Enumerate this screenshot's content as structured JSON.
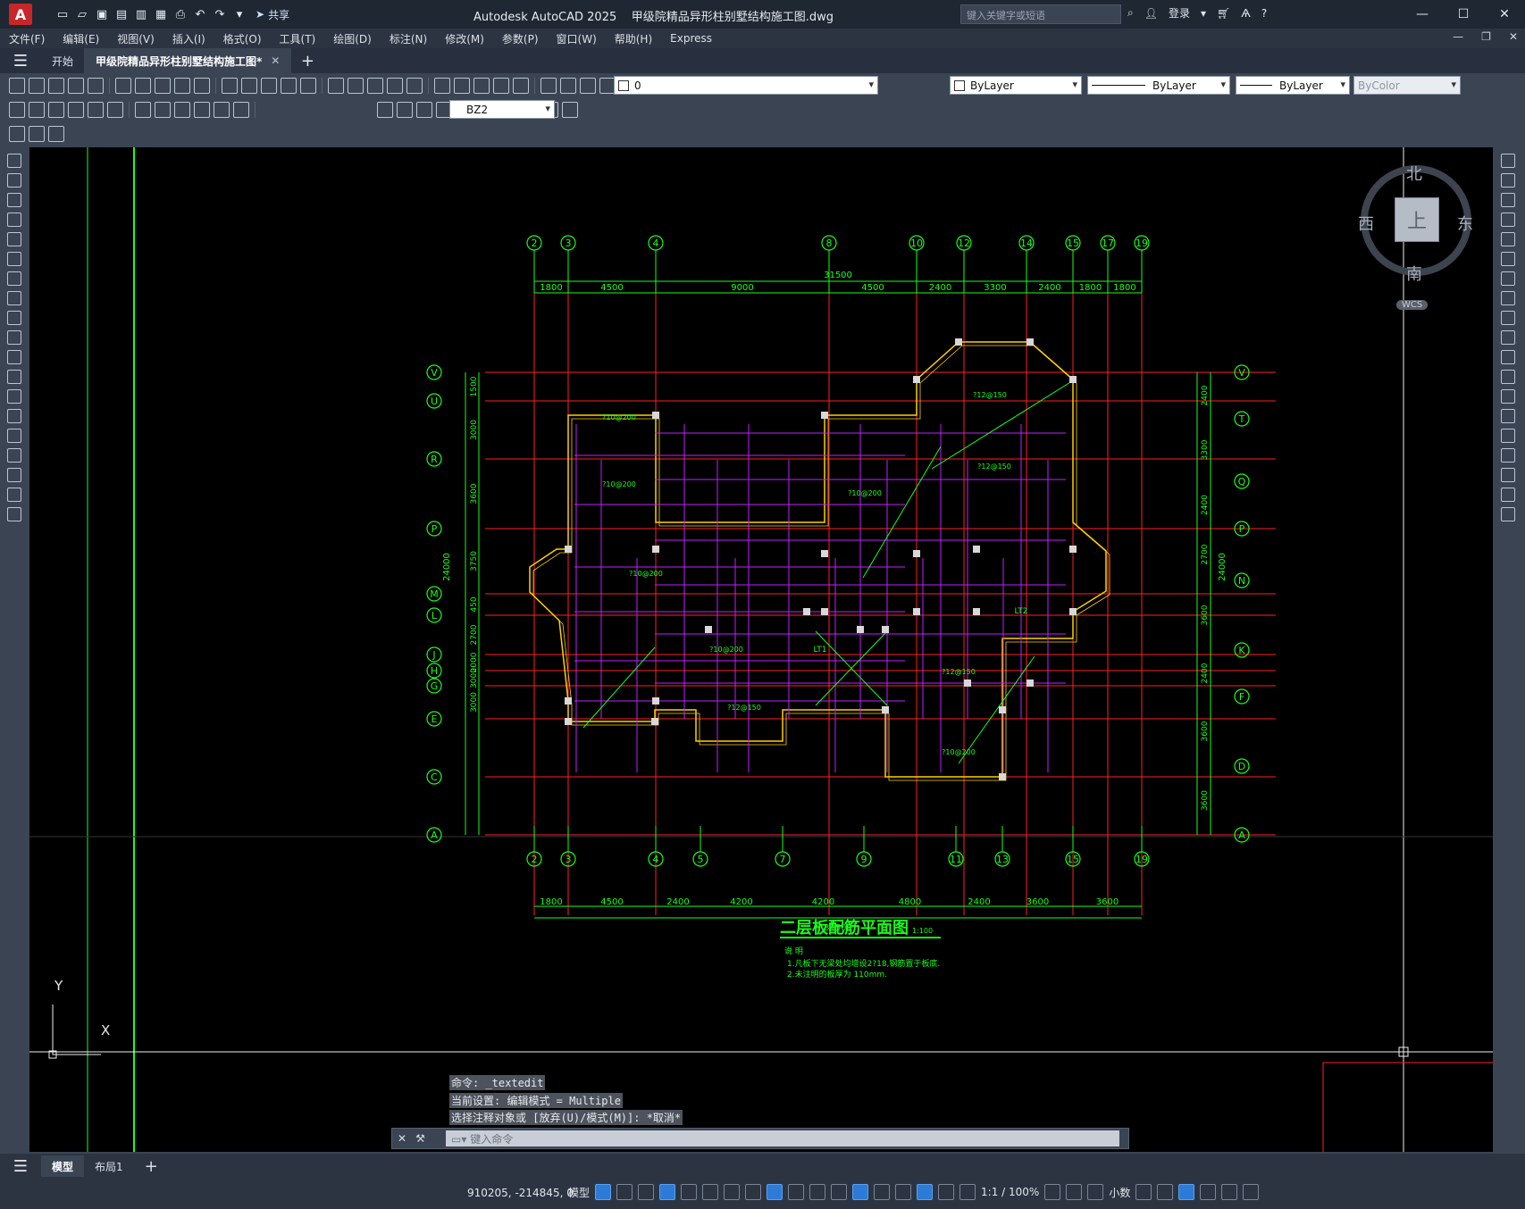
{
  "window": {
    "app_title": "Autodesk AutoCAD 2025",
    "file_title": "甲级院精品异形柱别墅结构施工图.dwg",
    "search_placeholder": "键入关键字或短语",
    "login": "登录",
    "share": "共享"
  },
  "menu": [
    "文件(F)",
    "编辑(E)",
    "视图(V)",
    "插入(I)",
    "格式(O)",
    "工具(T)",
    "绘图(D)",
    "标注(N)",
    "修改(M)",
    "参数(P)",
    "窗口(W)",
    "帮助(H)",
    "Express"
  ],
  "tabs": [
    {
      "label": "开始",
      "active": false
    },
    {
      "label": "甲级院精品异形柱别墅结构施工图*",
      "active": true
    }
  ],
  "toolbar": {
    "layer_value": "0",
    "color_value": "ByLayer",
    "linetype_value": "ByLayer",
    "lineweight_value": "ByLayer",
    "plotstyle_value": "ByColor",
    "dimstyle_value": "BZ2"
  },
  "viewcube": {
    "north": "北",
    "south": "南",
    "east": "东",
    "west": "西",
    "top": "上",
    "wcs": "WCS"
  },
  "drawing": {
    "title": "二层板配筋平面图",
    "scale": "1:100",
    "notes_heading": "说 明",
    "note1": "1.凡板下无梁处均增设2?18,钢筋置于板底.",
    "note2": "2.未注明的板厚为 110mm.",
    "overall_dim": "31500",
    "top_axes": [
      "2",
      "3",
      "4",
      "8",
      "10",
      "12",
      "14",
      "15",
      "17",
      "19"
    ],
    "bottom_axes": [
      "2",
      "3",
      "4",
      "5",
      "7",
      "9",
      "11",
      "13",
      "15",
      "19"
    ],
    "top_dims": [
      "1800",
      "4500",
      "9000",
      "4500",
      "2400",
      "3300",
      "2400",
      "1800",
      "1800"
    ],
    "bottom_dims": [
      "1800",
      "4500",
      "2400",
      "4200",
      "4200",
      "4800",
      "2400",
      "3600",
      "3600"
    ],
    "left_axes": [
      "V",
      "U",
      "R",
      "P",
      "M",
      "L",
      "J",
      "H",
      "G",
      "E",
      "C",
      "A"
    ],
    "right_axes": [
      "V",
      "T",
      "Q",
      "P",
      "N",
      "K",
      "F",
      "D",
      "A"
    ],
    "left_dims": [
      "1500",
      "3000",
      "3600",
      "3750",
      "450",
      "2700",
      "2000",
      "3000",
      "3000"
    ],
    "right_dims": [
      "2400",
      "3300",
      "2400",
      "2700",
      "3600",
      "2400",
      "3600",
      "3600"
    ],
    "side_total": "24000",
    "slab_labels": [
      "?10@200",
      "?12@150",
      "?10@200",
      "?12@150",
      "?10@200",
      "?10@200",
      "?12@150",
      "?10@200",
      "?10@200",
      "?12@150"
    ],
    "lt_labels": [
      "LT1",
      "LT2"
    ]
  },
  "command_history": [
    "命令: _textedit",
    "当前设置: 编辑模式 = Multiple",
    "选择注释对象或 [放弃(U)/模式(M)]: *取消*"
  ],
  "command_placeholder": "键入命令",
  "layout_tabs": [
    {
      "label": "模型",
      "active": true
    },
    {
      "label": "布局1",
      "active": false
    }
  ],
  "status": {
    "coords": "910205, -214845, 0",
    "mode": "模型",
    "scale": "1:1 / 100%",
    "units": "小数"
  },
  "ucs": {
    "y_label": "Y",
    "x_label": "X"
  }
}
